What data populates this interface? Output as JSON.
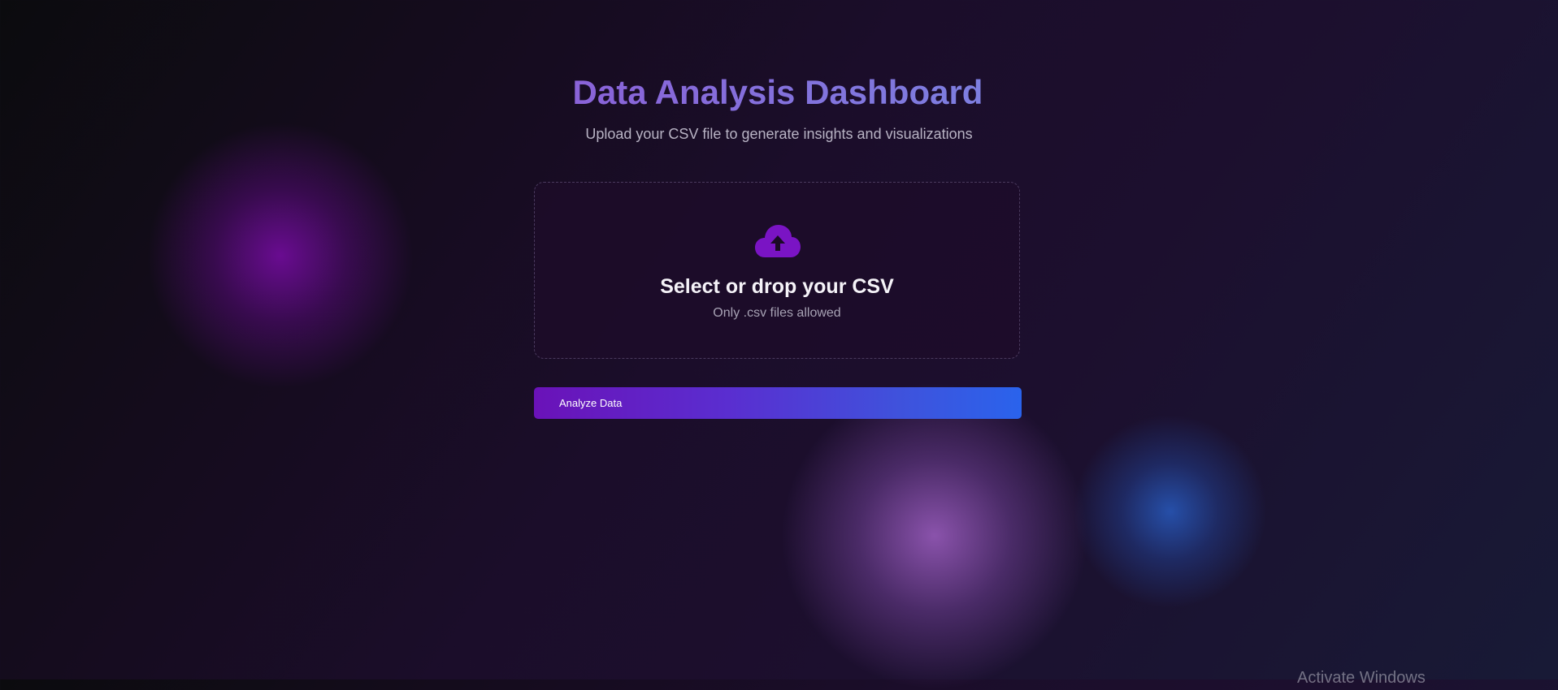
{
  "header": {
    "title": "Data Analysis Dashboard",
    "subtitle": "Upload your CSV file to generate insights and visualizations"
  },
  "upload": {
    "icon": "cloud-upload-icon",
    "title": "Select or drop your CSV",
    "hint": "Only .csv files allowed"
  },
  "actions": {
    "analyze_label": "Analyze Data"
  },
  "overlay": {
    "watermark": "Activate Windows"
  },
  "colors": {
    "accent_purple": "#6a12b8",
    "accent_blue": "#2a63ec",
    "icon_purple": "#7a14c4",
    "title_gradient_start": "#8a62d8",
    "title_gradient_end": "#7d7fe0"
  }
}
